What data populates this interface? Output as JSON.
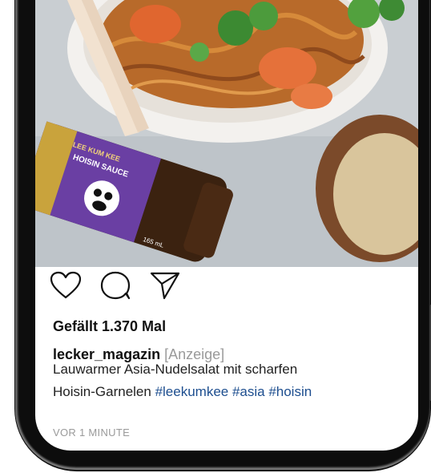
{
  "post": {
    "likes_text": "Gefällt 1.370 Mal",
    "username": "lecker_magazin",
    "ad_tag": "[Anzeige]",
    "caption_line1": "Lauwarmer Asia-Nudelsalat mit scharfen",
    "caption_line2": "Hoisin-Garnelen ",
    "hashtags": "#leekumkee #asia #hoisin",
    "time": "VOR 1 MINUTE"
  },
  "photo": {
    "bottle_label": "HOISIN SAUCE",
    "bottle_brand": "LEE KUM KEE",
    "bottle_volume": "165 mL"
  },
  "icons": {
    "like": "heart-icon",
    "comment": "comment-icon",
    "share": "paper-plane-icon"
  }
}
